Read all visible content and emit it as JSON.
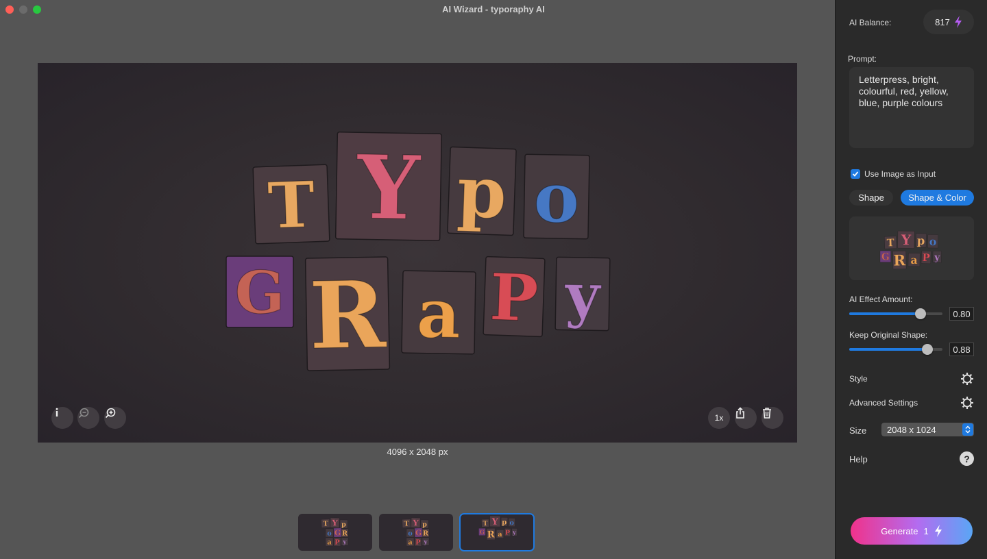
{
  "window": {
    "title": "AI Wizard - typoraphy AI"
  },
  "canvas": {
    "tiles": [
      {
        "letter": "T",
        "fill": "#e8a861",
        "tile": "#4a3c41"
      },
      {
        "letter": "Y",
        "fill": "#d65f77",
        "tile": "#4f3c43"
      },
      {
        "letter": "p",
        "fill": "#e8a861",
        "tile": "#463a3f"
      },
      {
        "letter": "o",
        "fill": "#4678c4",
        "tile": "#453a3f"
      },
      {
        "letter": "G",
        "fill": "#c46355",
        "tile": "#6a3d7a"
      },
      {
        "letter": "R",
        "fill": "#eaa55a",
        "tile": "#4b3c42"
      },
      {
        "letter": "a",
        "fill": "#eca04a",
        "tile": "#463a3f"
      },
      {
        "letter": "P",
        "fill": "#d84c55",
        "tile": "#493b40"
      },
      {
        "letter": "y",
        "fill": "#b07bc0",
        "tile": "#443a40"
      }
    ],
    "dimensions_label": "4096 x 2048 px",
    "zoom_label": "1x"
  },
  "toolbar_icons": {
    "info": "info-icon",
    "zoom_out": "zoom-out-icon",
    "zoom_in": "zoom-in-icon",
    "share": "share-icon",
    "delete": "trash-icon"
  },
  "sidebar": {
    "balance_label": "AI Balance:",
    "balance_value": "817",
    "prompt_label": "Prompt:",
    "prompt_text": "Letterpress, bright, colourful, red, yellow, blue, purple colours",
    "use_image_label": "Use Image as Input",
    "use_image_checked": true,
    "mode_options": [
      "Shape",
      "Shape & Color"
    ],
    "mode_selected": "Shape & Color",
    "effect_label": "AI Effect Amount:",
    "effect_value": "0.80",
    "keep_shape_label": "Keep Original Shape:",
    "keep_shape_value": "0.88",
    "style_label": "Style",
    "advanced_label": "Advanced Settings",
    "size_label": "Size",
    "size_value": "2048 x 1024",
    "help_label": "Help",
    "help_glyph": "?",
    "generate_label": "Generate",
    "generate_cost": "1"
  },
  "colors": {
    "accent": "#1f7ae0",
    "bolt": "#b45cf0"
  }
}
